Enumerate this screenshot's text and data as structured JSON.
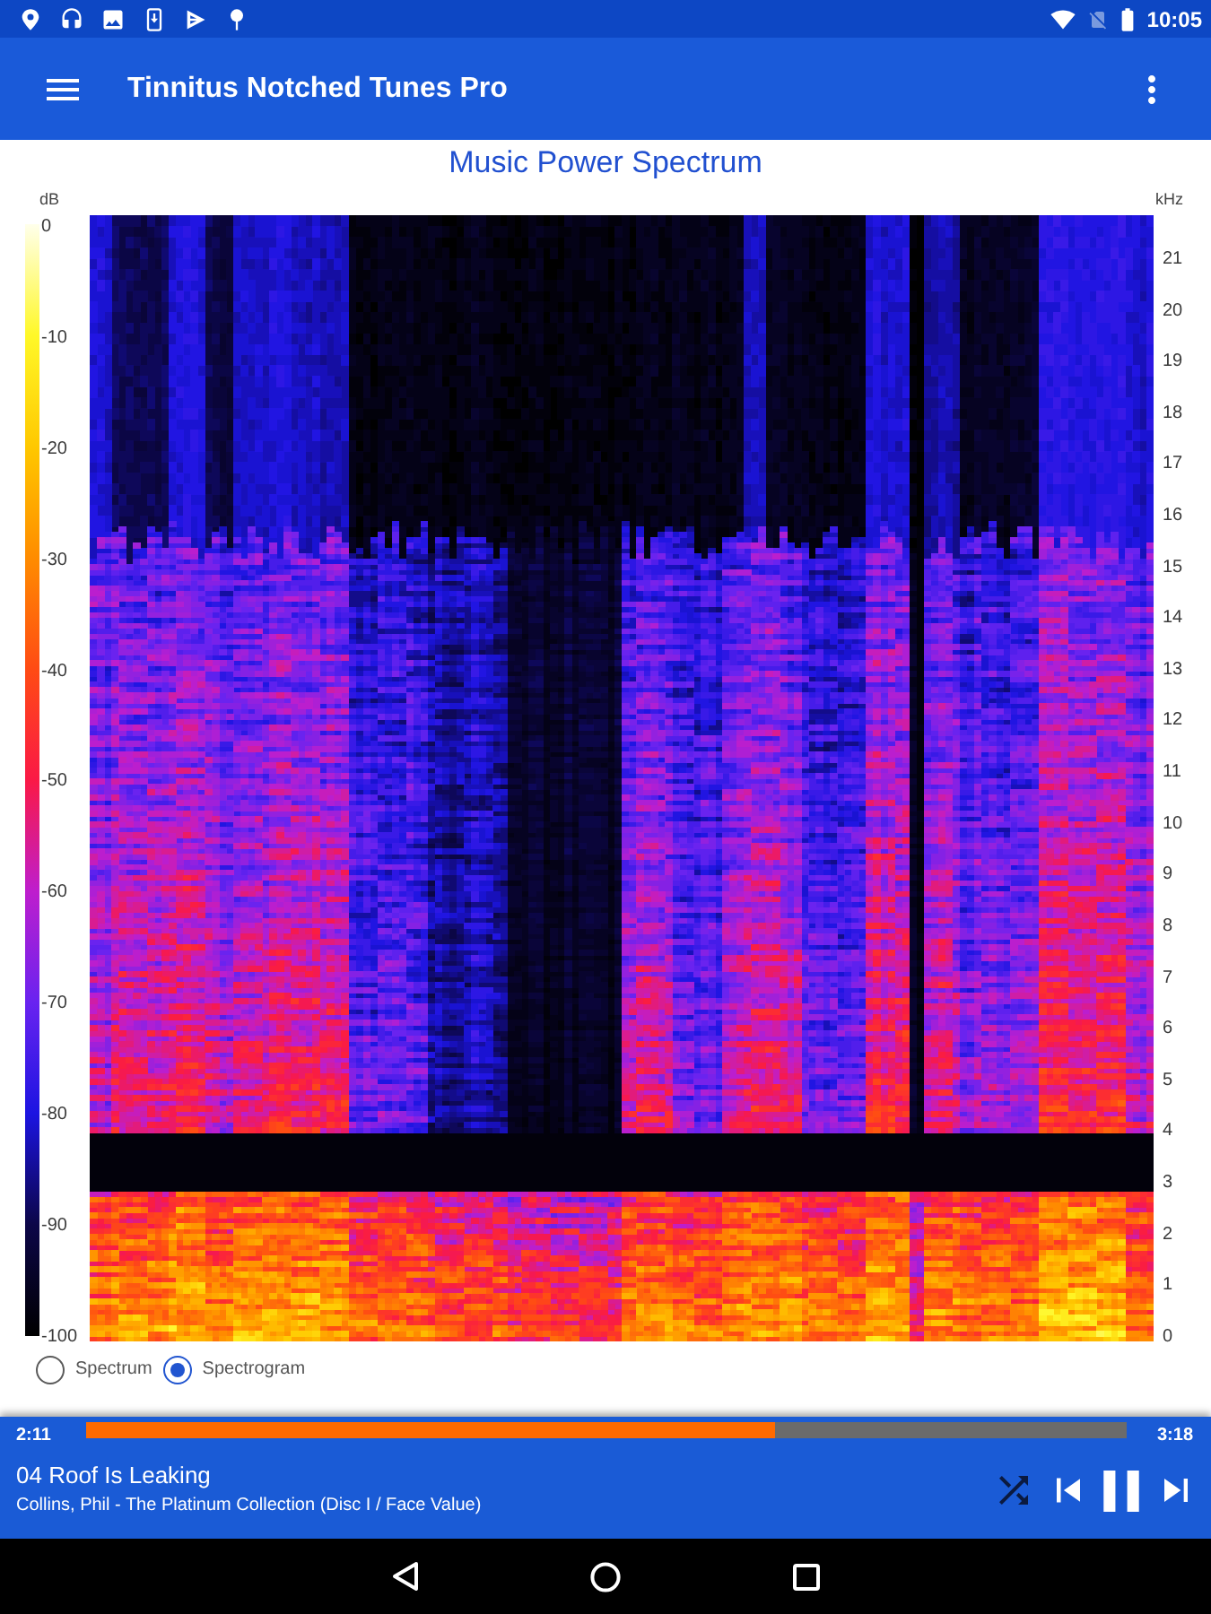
{
  "status_bar": {
    "time": "10:05"
  },
  "app_bar": {
    "title": "Tinnitus Notched Tunes Pro"
  },
  "chart": {
    "title": "Music Power Spectrum",
    "color_scale": {
      "unit": "dB",
      "ticks": [
        "0",
        "-10",
        "-20",
        "-30",
        "-40",
        "-50",
        "-60",
        "-70",
        "-80",
        "-90",
        "-100"
      ]
    },
    "frequency_axis": {
      "unit": "kHz",
      "ticks": [
        "21",
        "20",
        "19",
        "18",
        "17",
        "16",
        "15",
        "14",
        "13",
        "12",
        "11",
        "10",
        "9",
        "8",
        "7",
        "6",
        "5",
        "4",
        "3",
        "2",
        "1",
        "0"
      ]
    }
  },
  "view_modes": [
    {
      "label": "Spectrum",
      "selected": false
    },
    {
      "label": "Spectrogram",
      "selected": true
    }
  ],
  "player": {
    "elapsed": "2:11",
    "duration": "3:18",
    "level": 0.662,
    "track_title": "04 Roof Is Leaking",
    "track_info": "Collins, Phil - The Platinum Collection (Disc I / Face Value)",
    "shuffle_on": false,
    "playing": true
  }
}
